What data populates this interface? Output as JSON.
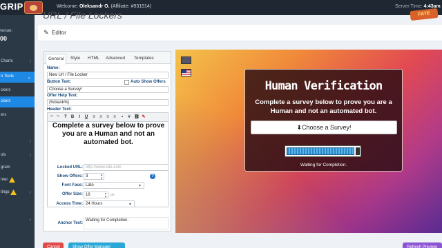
{
  "topbar": {
    "logo_text": "GRIP",
    "welcome_prefix": "Welcome:",
    "user_name": "Oleksandr O.",
    "affiliate": "(Affiliate: #931514)",
    "server_time_label": "Server Time:",
    "server_time": "4:43am",
    "brand_badge": "FATE"
  },
  "sidebar": {
    "revenue_label": "venue:",
    "revenue_value": "00",
    "items": [
      {
        "label": "Charts"
      },
      {
        "label": "n Tools"
      },
      {
        "label": "ckers"
      },
      {
        "label": "ckers"
      },
      {
        "label": "ers"
      },
      {
        "label": "ols"
      },
      {
        "label": "gram"
      },
      {
        "label": "nter"
      },
      {
        "label": "tings"
      }
    ]
  },
  "page": {
    "title": "URL / File Lockers",
    "editor_label": "Editor"
  },
  "form": {
    "tabs": [
      "General",
      "Style",
      "HTML",
      "Advanced",
      "Templates"
    ],
    "name_label": "Name:",
    "name_value": "New Url / File Locker",
    "button_text_label": "Button Text:",
    "auto_show_offers_label": "Auto Show Offers",
    "button_text_value": "Choose a Survey!",
    "offer_help_label": "Offer Help Text:",
    "offer_help_value": "{%blank%}",
    "header_text_label": "Header Text:",
    "header_text_value": "Complete a survey below to prove you are a Human and not an automated bot.",
    "locked_url_label": "Locked URL:",
    "locked_url_placeholder": "http://www.site.com",
    "show_offers_label": "Show Offers:",
    "show_offers_value": "3",
    "font_face_label": "Font Face:",
    "font_face_value": "Lato",
    "offer_size_label": "Offer Size:",
    "offer_size_value": "16",
    "offer_size_unit": "px",
    "access_time_label": "Access Time:",
    "access_time_value": "24 Hours",
    "anchor_text_label": "Anchor Text:",
    "anchor_text_value": "Waiting for Completion."
  },
  "preview": {
    "title": "Human Verification",
    "subtitle": "Complete a survey below to prove you are a Human and not an automated bot.",
    "button_label": "Choose a Survey!",
    "progress_fraction": 0.93,
    "status": "Waiting for Completion."
  },
  "bottom": {
    "cancel_label": "Cancel",
    "offer_manager_label": "Show Offer Manager",
    "refresh_label": "Refresh Preview"
  }
}
